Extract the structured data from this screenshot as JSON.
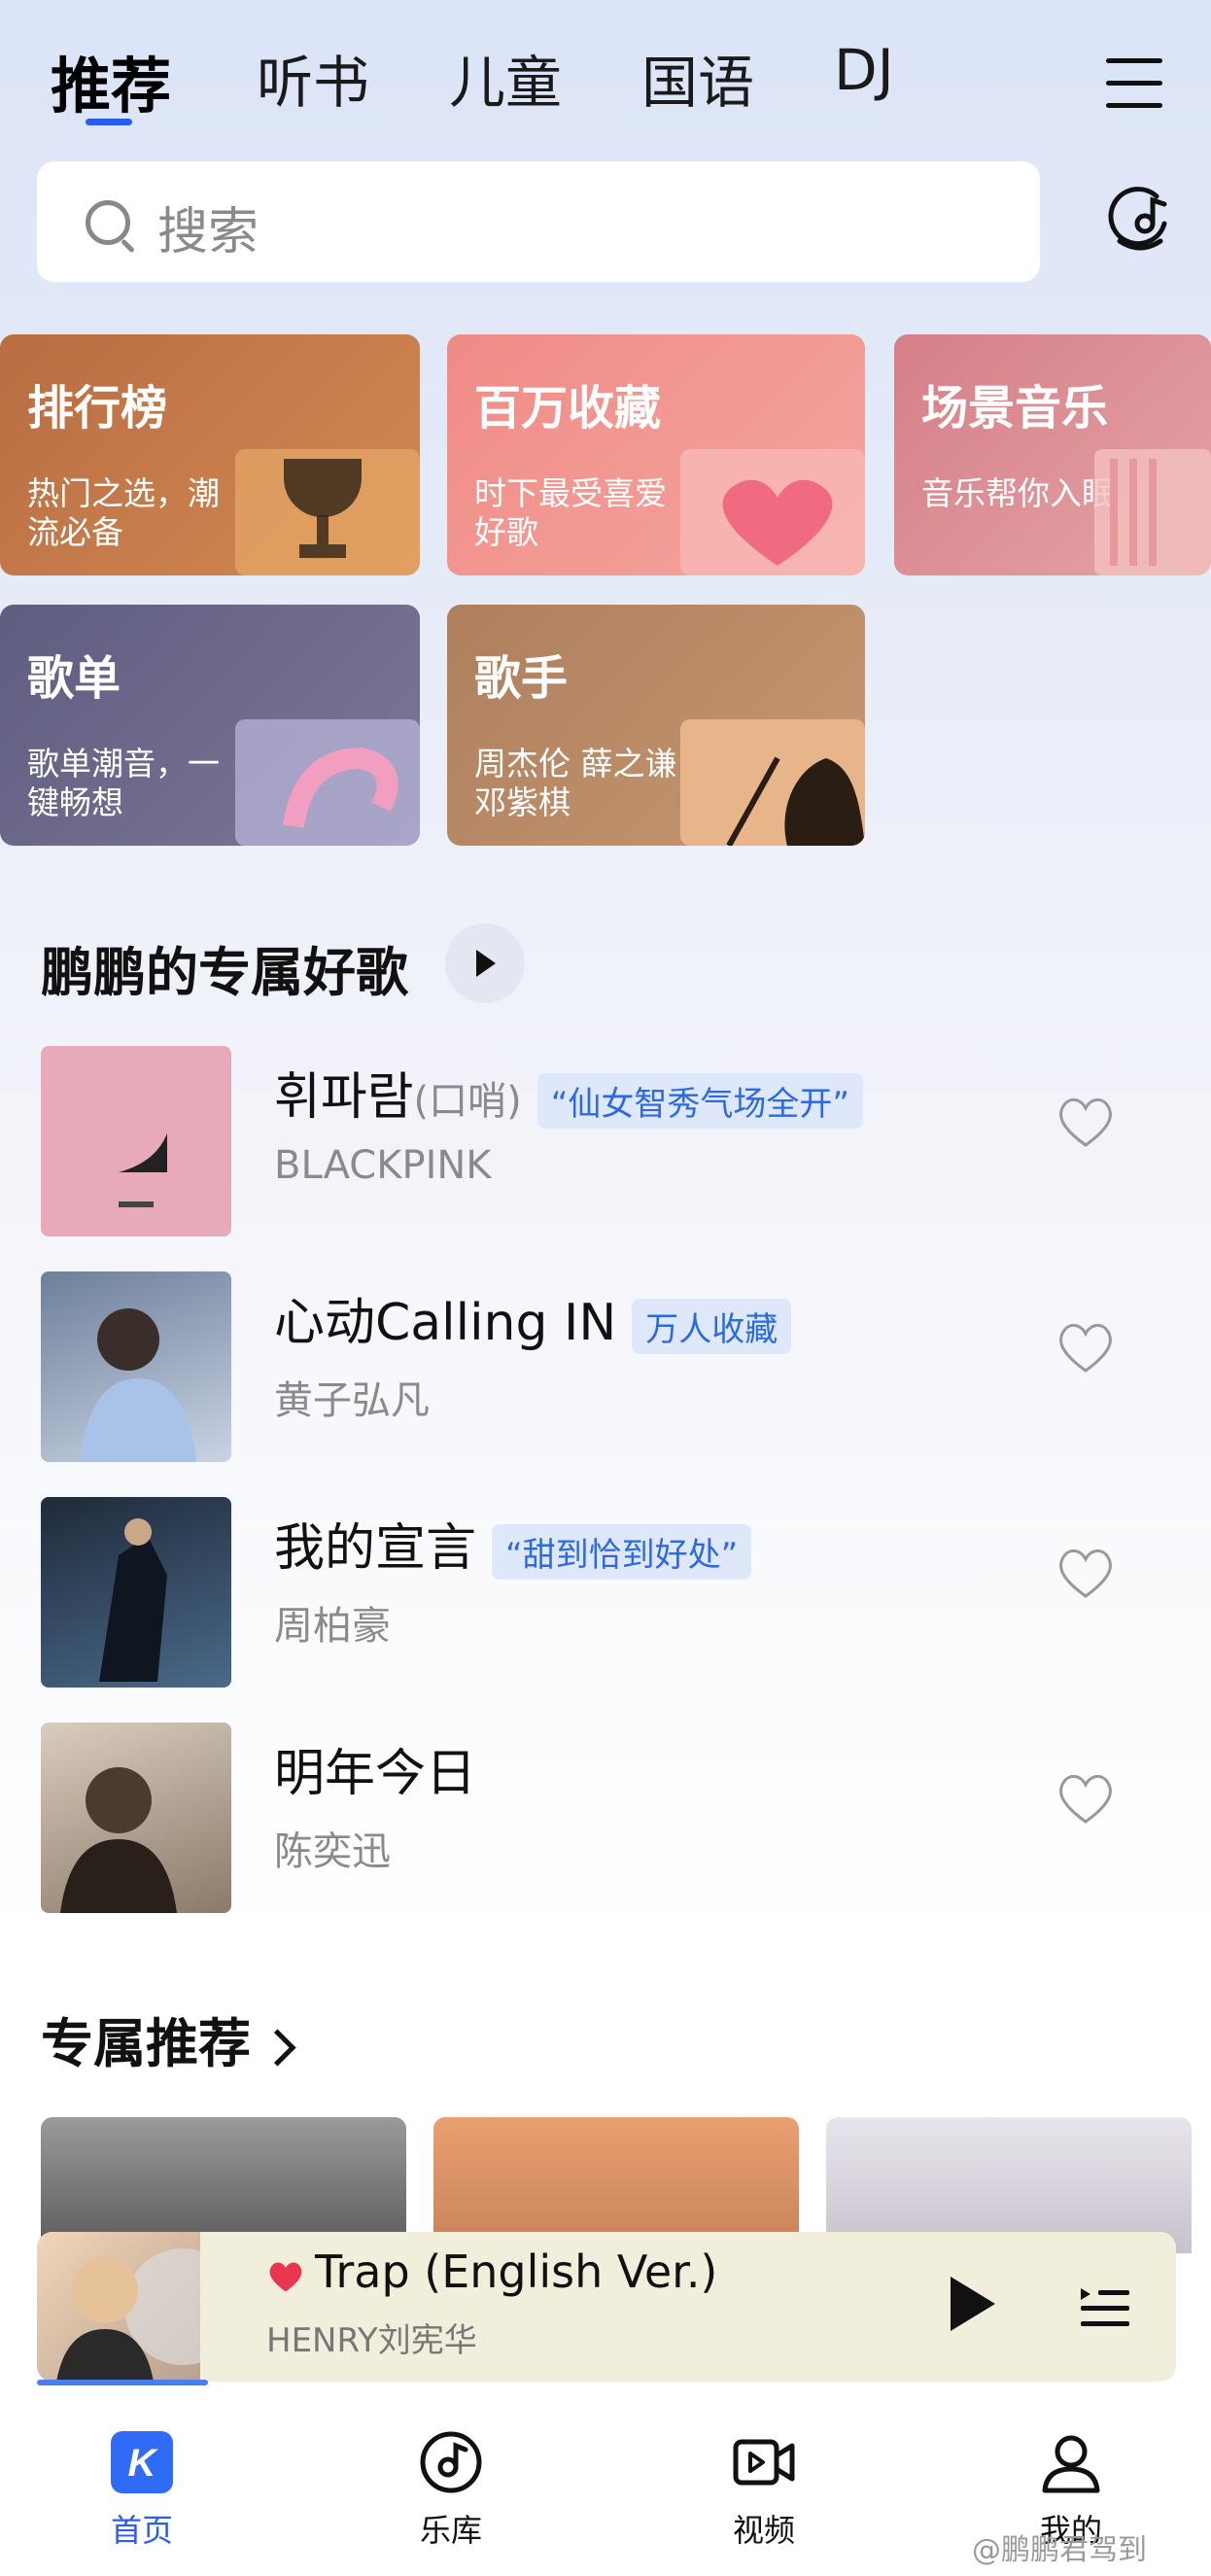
{
  "tabs": [
    {
      "label": "推荐",
      "active": true
    },
    {
      "label": "听书",
      "active": false
    },
    {
      "label": "儿童",
      "active": false
    },
    {
      "label": "国语",
      "active": false
    },
    {
      "label": "DJ",
      "active": false
    }
  ],
  "search": {
    "placeholder": "搜索"
  },
  "categories": [
    {
      "title": "排行榜",
      "subtitle": "热门之选，潮流必备",
      "color": "#c0784a"
    },
    {
      "title": "百万收藏",
      "subtitle": "时下最受喜爱好歌",
      "color": "#ef8f8b"
    },
    {
      "title": "场景音乐",
      "subtitle": "音乐帮你入眠",
      "color": "#d98a92"
    },
    {
      "title": "歌单",
      "subtitle": "歌单潮音，一键畅想",
      "color": "#6f6c8c"
    },
    {
      "title": "歌手",
      "subtitle": "周杰伦 薛之谦 邓紫棋",
      "color": "#b88a68"
    }
  ],
  "exclusive": {
    "title": "鹏鹏的专属好歌",
    "songs": [
      {
        "title": "휘파람",
        "title_note": "(口哨)",
        "tag": "“仙女智秀气场全开”",
        "artist": "BLACKPINK"
      },
      {
        "title": "心动Calling IN",
        "title_note": "",
        "tag": "万人收藏",
        "artist": "黄子弘凡"
      },
      {
        "title": "我的宣言",
        "title_note": "",
        "tag": "“甜到恰到好处”",
        "artist": "周柏豪"
      },
      {
        "title": "明年今日",
        "title_note": "",
        "tag": "",
        "artist": "陈奕迅"
      }
    ]
  },
  "recommend": {
    "title": "专属推荐"
  },
  "player": {
    "title": "Trap (English Ver.)",
    "artist": "HENRY刘宪华",
    "progress": 0.15,
    "liked": true
  },
  "nav": [
    {
      "label": "首页",
      "icon": "k-logo-icon",
      "active": true
    },
    {
      "label": "乐库",
      "icon": "vinyl-icon",
      "active": false
    },
    {
      "label": "视频",
      "icon": "video-icon",
      "active": false
    },
    {
      "label": "我的",
      "icon": "user-icon",
      "active": false
    }
  ],
  "watermark": "@鹏鹏君驾到",
  "colors": {
    "accent": "#2a5cf0",
    "tag_text": "#2d6ae0",
    "tag_bg": "#dfe8fb",
    "heart": "#e8364f"
  }
}
